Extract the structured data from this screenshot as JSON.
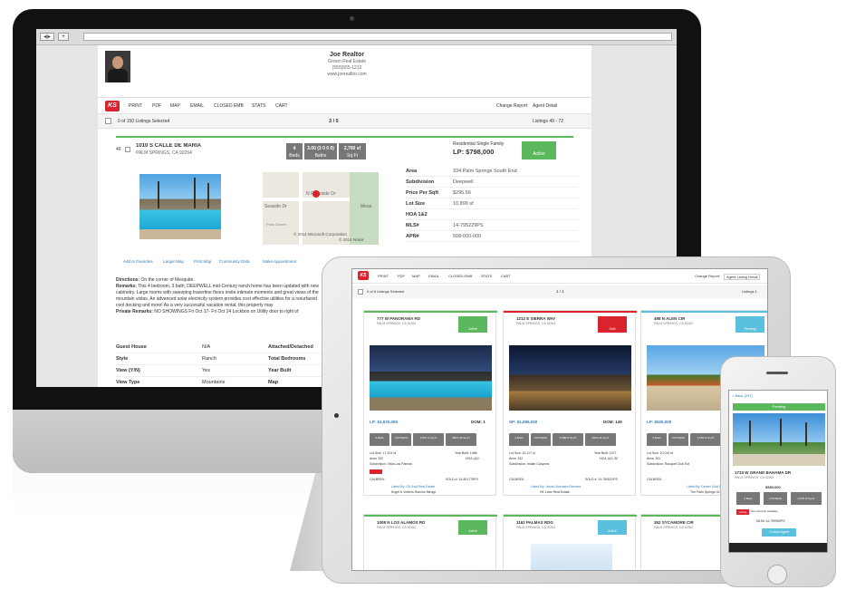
{
  "desktop": {
    "agent": {
      "name": "Joe Realtor",
      "company": "Grown Real Estate",
      "phone": "(555)555-1212",
      "website": "www.joerealtor.com"
    },
    "toolbar": {
      "logo": "KS",
      "items": [
        "PRINT",
        "PDF",
        "MAP",
        "EMAIL",
        "CLOSED EMB",
        "STATS",
        "CART"
      ],
      "change_report": "Change Report:",
      "report_value": "Agent Detail"
    },
    "selection": {
      "selected_text": "0 of 150 Listings Selected",
      "pager": "3 / 5",
      "range_text": "Listings 49 - 72"
    },
    "listing": {
      "number": "49",
      "address": "1010 S CALLE DE MARIA",
      "city": "PALM SPRINGS, CA 92264",
      "stats": [
        {
          "value": "4",
          "label": "Beds"
        },
        {
          "value": "3.00 (3 0 0 0)",
          "label": "Baths"
        },
        {
          "value": "2,700 sf",
          "label": "Sq Ft"
        }
      ],
      "type": "Residential Single Family",
      "price": "LP: $798,000",
      "status": "Active",
      "map": {
        "street1": "N Riverside Dr",
        "street2": "Seaside Dr",
        "label3": "Mesa",
        "label4": "Palm Desert",
        "copyright1": "© 2014 Microsoft Corporation",
        "copyright2": "© 2014 Nokia"
      },
      "fields": [
        {
          "k": "Area",
          "v": "334 Palm Springs South End"
        },
        {
          "k": "Subdivision",
          "v": "Deepwell"
        },
        {
          "k": "Price Per Sqft",
          "v": "$295.56"
        },
        {
          "k": "Lot Size",
          "v": "10,890 sf"
        },
        {
          "k": "HOA 1&2",
          "v": ""
        },
        {
          "k": "MLS#",
          "v": "14-795229PS"
        },
        {
          "k": "APN#",
          "v": "508-000-000"
        }
      ],
      "links": [
        "Add to Favorites",
        "Larger Map",
        "Print Map",
        "Community Data",
        "Make Appointment"
      ],
      "directions_label": "Directions:",
      "directions": "On the corner of Mesquite.",
      "remarks_label": "Remarks:",
      "remarks": "This 4 bedroom, 3 bath, DEEPWELL mid-Century ranch home has been updated with new cabinetry. Large rooms with sweeping travertine floors invite intimate moments and great views of the mountain vistas. An advanced solar electricity system provides cost effective utilities for a resurfaced cool decking and more! As a very successful vacation rental, this property may",
      "private_label": "Private Remarks:",
      "private": "NO SHOWINGS Fri Oct 17- Fri Oct 24 Lockbox on Utility door to right of",
      "details": [
        {
          "k": "Guest House",
          "v": "N/A",
          "k2": "Attached/Detached",
          "v2": ""
        },
        {
          "k": "Style",
          "v": "Ranch",
          "k2": "Total Bedrooms",
          "v2": ""
        },
        {
          "k": "View (Y/N)",
          "v": "Yes",
          "k2": "Year Built",
          "v2": ""
        },
        {
          "k": "View Type",
          "v": "Mountains",
          "k2": "Map",
          "v2": ""
        }
      ]
    }
  },
  "tablet": {
    "toolbar_items": [
      "PRINT",
      "PDF",
      "MAP",
      "EMAIL",
      "CLOSED EMB",
      "STATS",
      "CART"
    ],
    "change_report": "Change Report:",
    "report_value": "Agent Listing Detail",
    "selected_text": "0 of 6 Listings Selected",
    "pager": "1 / 1",
    "listings_label": "Listings 1",
    "cards": [
      {
        "address": "777 W PANORAMA RD",
        "city": "PALM SPRINGS, CA 92262",
        "status": "Active",
        "status_color": "#5cb85c",
        "price": "LP: $1,570,000",
        "dom": "DOM: 1",
        "stats": [
          "3 Beds",
          "3.00 Baths",
          "2,527 sf Sq Ft",
          "$621.30 Sq Ft"
        ],
        "lot": "Lot Size: 17,424 sf",
        "year": "Year Built: 1966",
        "area": "Area: 332",
        "hoa": "HOA 1&2:",
        "subdivision": "Subdivision: Vista Las Palmas",
        "calbre": "CALBRE#:",
        "sold": "SOLD #: 14-801775PS",
        "listed_by": "Listed By: Gil Gold Real Estate",
        "listed_office": "Engel & Volkers Rancho Mirage"
      },
      {
        "address": "1212 E SIERRA WAY",
        "city": "PALM SPRINGS, CA 92264",
        "status": "Sold",
        "status_color": "#d9232d",
        "price": "SP: $1,095,000",
        "dom": "DOM: 145",
        "stats": [
          "4 Beds",
          "3.00 Baths",
          "2,588 sf Sq Ft",
          "$423.11 Sq Ft"
        ],
        "lot": "Lot Size: 16,117 sf",
        "year": "Year Built: 1977",
        "area": "Area: 332",
        "hoa": "HOA 1&2: $0",
        "subdivision": "Subdivision: Indian Canyons",
        "calbre": "CALBRE#:",
        "sold": "SOLD #: 14-760531PS",
        "listed_by": "Listed By: Jesus Gonzalez-Ramirez",
        "listed_office": "HK Lane Real Estate"
      },
      {
        "address": "498 N ALEN CIR",
        "city": "PALM SPRINGS, CA 92262",
        "status": "Pending",
        "status_color": "#5bc0de",
        "price": "LP: $525,000",
        "dom": "",
        "stats": [
          "3 Beds",
          "2.00 Baths",
          "1,652 sf Sq Ft",
          "$317.8 Sq Ft"
        ],
        "lot": "Lot Size: 10,019 sf",
        "year": "",
        "area": "Area: 331",
        "hoa": "",
        "subdivision": "Subdivision: Racquet Club Est",
        "calbre": "CALBRE#:",
        "sold": "",
        "listed_by": "Listed By: Desert Gold Properties",
        "listed_office": "The Palm Springs Group"
      }
    ],
    "row2": [
      {
        "address": "1008 N LOS ALAMOS RD",
        "city": "PALM SPRINGS, CA 92262",
        "status": "Active"
      },
      {
        "address": "1162 PALMAS RDG",
        "city": "PALM SPRINGS, CA 92262",
        "status": "Active"
      },
      {
        "address": "352 SYCAMORE CIR",
        "city": "PALM SPRINGS, CA 92262",
        "status": "Active"
      }
    ]
  },
  "phone": {
    "back": "< Back (297)",
    "status": "Pending",
    "address": "1733 W GRAND BAHAMA DR",
    "city": "PALM SPRINGS, CA 92264",
    "price": "$550,000",
    "stats": [
      "3 Beds",
      "2.00 Baths",
      "1,575 sf Sq Ft"
    ],
    "warn_label": "Listing",
    "warn_text": "Not currently available",
    "mls": "MLS# 14-799989PS",
    "contact": "Contact Agent"
  },
  "colors": {
    "brand_red": "#d9232d",
    "active_green": "#5cb85c",
    "pending_blue": "#5bc0de"
  }
}
